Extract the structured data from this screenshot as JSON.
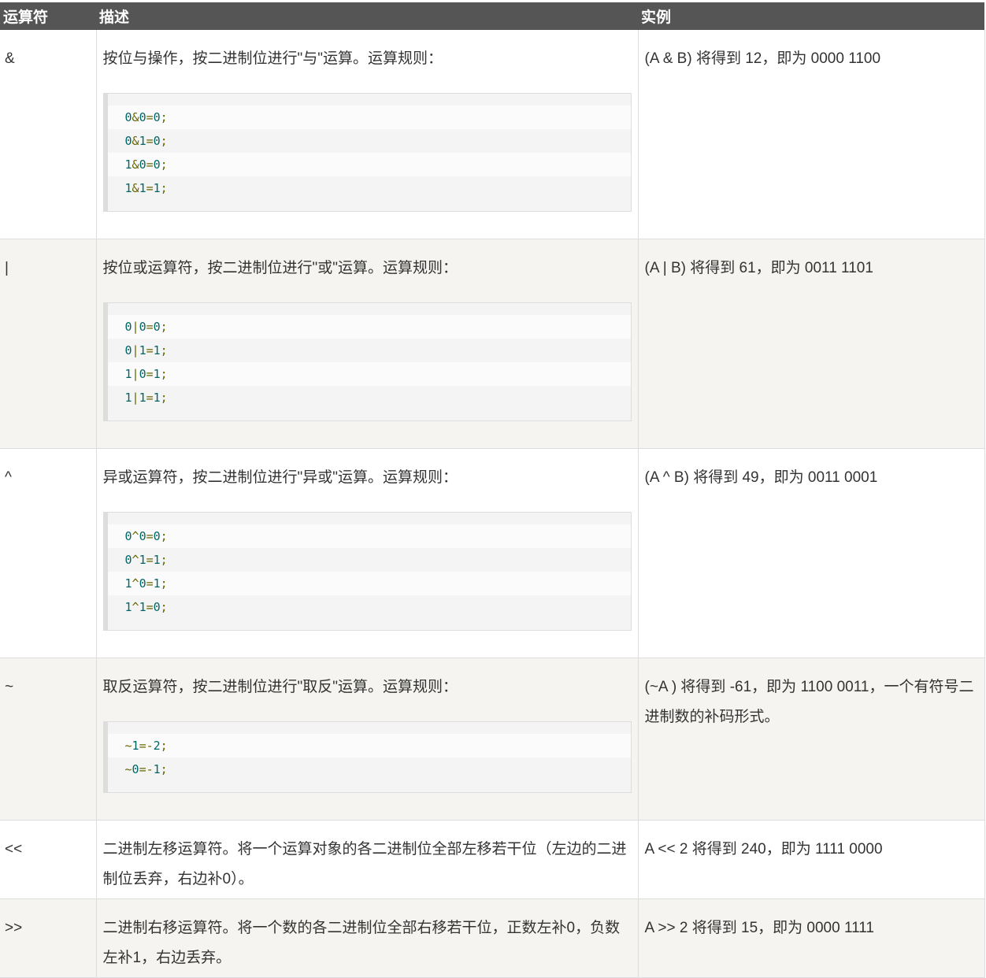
{
  "headers": [
    "运算符",
    "描述",
    "实例"
  ],
  "rows": [
    {
      "op": "&",
      "desc": "按位与操作，按二进制位进行\"与\"运算。运算规则：",
      "code": [
        "0&0=0;",
        "0&1=0;",
        "1&0=0;",
        "1&1=1;"
      ],
      "example": "(A & B) 将得到 12，即为 0000 1100"
    },
    {
      "op": "|",
      "desc": "按位或运算符，按二进制位进行\"或\"运算。运算规则：",
      "code": [
        "0|0=0;",
        "0|1=1;",
        "1|0=1;",
        "1|1=1;"
      ],
      "example": "(A | B) 将得到 61，即为 0011 1101"
    },
    {
      "op": "^",
      "desc": "异或运算符，按二进制位进行\"异或\"运算。运算规则：",
      "code": [
        "0^0=0;",
        "0^1=1;",
        "1^0=1;",
        "1^1=0;"
      ],
      "example": "(A ^ B) 将得到 49，即为 0011 0001"
    },
    {
      "op": "~",
      "desc": "取反运算符，按二进制位进行\"取反\"运算。运算规则：",
      "code": [
        "~1=-2;",
        "~0=-1;"
      ],
      "example": "(~A ) 将得到 -61，即为 1100 0011，一个有符号二进制数的补码形式。"
    },
    {
      "op": "<<",
      "desc": "二进制左移运算符。将一个运算对象的各二进制位全部左移若干位（左边的二进制位丢弃，右边补0）。",
      "code": [],
      "example": "A << 2 将得到 240，即为 1111 0000"
    },
    {
      "op": ">>",
      "desc": "二进制右移运算符。将一个数的各二进制位全部右移若干位，正数左补0，负数左补1，右边丢弃。",
      "code": [],
      "example": "A >> 2 将得到 15，即为 0000 1111"
    }
  ]
}
